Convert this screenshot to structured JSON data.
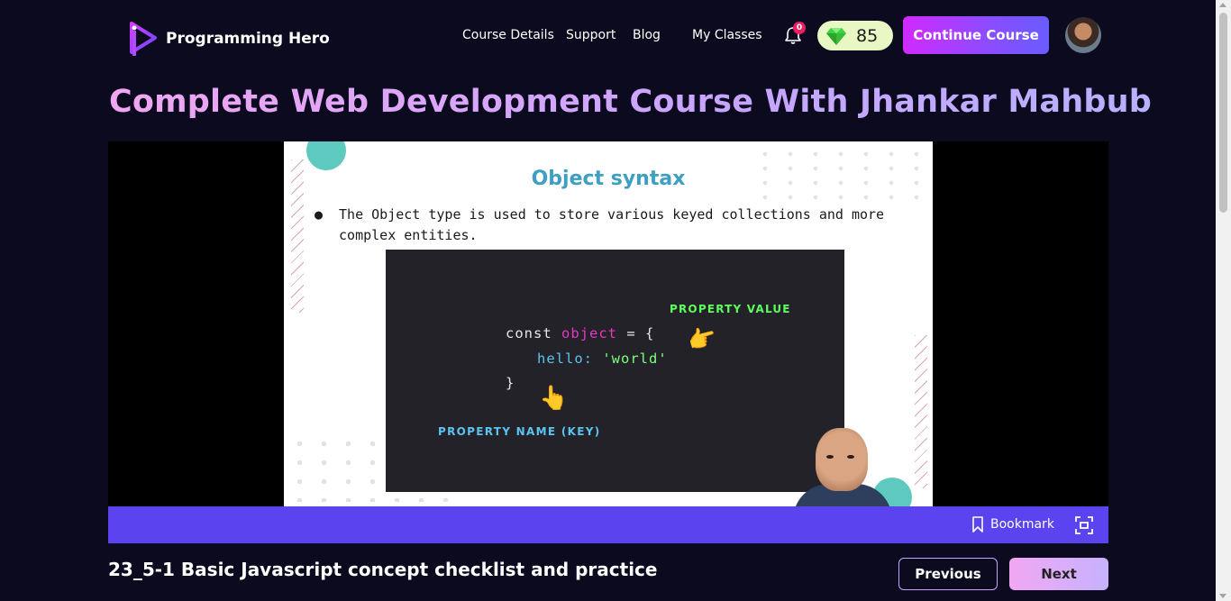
{
  "header": {
    "brand": "Programming Hero",
    "nav": {
      "course_details": "Course Details",
      "support": "Support",
      "blog": "Blog",
      "my_classes": "My Classes"
    },
    "notification_count": "0",
    "gems": "85",
    "continue_label": "Continue Course"
  },
  "course_title": "Complete Web Development Course With Jhankar Mahbub",
  "slide": {
    "title": "Object syntax",
    "bullet": "The Object type is used to store various keyed collections and more complex entities.",
    "property_value_label": "PROPERTY VALUE",
    "property_name_label": "PROPERTY NAME (KEY)",
    "code": {
      "const_kw": "const ",
      "obj_name": "object",
      "assign": " = {",
      "key": "hello: ",
      "value": "'world'",
      "close": "}"
    }
  },
  "player": {
    "bookmark_label": "Bookmark"
  },
  "lesson": {
    "title": "23_5-1 Basic Javascript concept checklist and practice",
    "previous_label": "Previous",
    "next_label": "Next"
  },
  "colors": {
    "background": "#0b0a1f",
    "accent_purple": "#5b43f0",
    "continue_gradient_start": "#d22aff",
    "gem_bg": "#e9f7c5",
    "slide_title": "#3e9fc2"
  }
}
